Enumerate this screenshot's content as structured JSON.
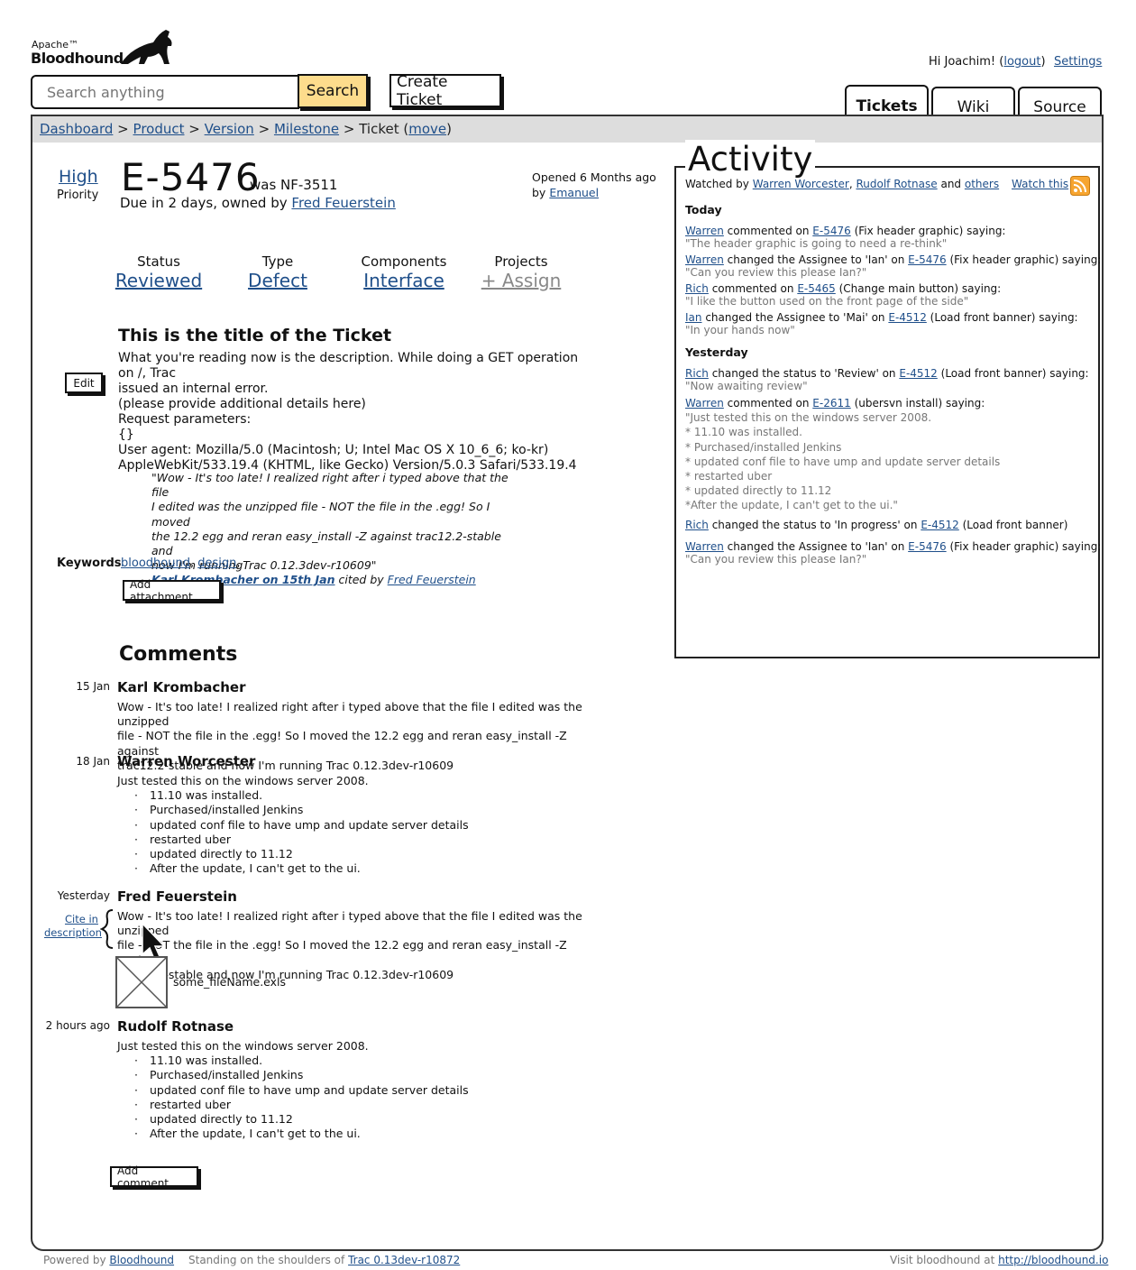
{
  "header": {
    "logo_apache": "Apache™",
    "logo_name": "Bloodhound",
    "greeting": "Hi Joachim! (",
    "logout": "logout",
    "greeting_end": ")",
    "settings": "Settings",
    "search_placeholder": "Search anything",
    "search_button": "Search",
    "create_ticket": "Create Ticket",
    "tabs": [
      {
        "label": "Tickets",
        "active": true
      },
      {
        "label": "Wiki",
        "active": false
      },
      {
        "label": "Source",
        "active": false
      }
    ]
  },
  "breadcrumb": {
    "items": [
      "Dashboard",
      "Product",
      "Version",
      "Milestone"
    ],
    "sep": ">",
    "current": "Ticket (",
    "move": "move",
    "current_end": ")"
  },
  "ticket": {
    "priority_value": "High",
    "priority_label": "Priority",
    "id": "E-5476",
    "was": "was NF-3511",
    "due": "Due in 2 days, owned by",
    "owner": "Fred Feuerstein",
    "opened": "Opened 6 Months ago",
    "opened_by": "by",
    "opened_by_name": "Emanuel",
    "fields": [
      {
        "label": "Status",
        "value": "Reviewed"
      },
      {
        "label": "Type",
        "value": "Defect"
      },
      {
        "label": "Components",
        "value": "Interface"
      },
      {
        "label": "Projects",
        "value": "+ Assign"
      }
    ],
    "title": "This is the title of the Ticket",
    "edit": "Edit",
    "description": [
      "What you're reading now is the description. While doing a GET operation on /, Trac",
      "issued an internal error.",
      "(please provide additional details here)",
      "Request parameters:",
      "{}",
      "User agent: Mozilla/5.0 (Macintosh; U; Intel Mac OS X 10_6_6; ko-kr)",
      "AppleWebKit/533.19.4 (KHTML, like Gecko) Version/5.0.3 Safari/533.19.4"
    ],
    "quote": [
      "\"Wow - It's too late! I realized right after i typed above that the file",
      "I edited was the unzipped file - NOT the file in the .egg! So I moved",
      "the 12.2 egg and reran easy_install -Z against trac12.2-stable and",
      "now I'm runningTrac 0.12.3dev-r10609\""
    ],
    "quote_author": "Karl Krombacher on 15th Jan",
    "quote_cited": "cited by",
    "quote_cited_by": "Fred Feuerstein",
    "keywords_label": "Keywords",
    "keywords": [
      "bloodhound",
      "design"
    ],
    "add_attachment": "Add attachment"
  },
  "comments": {
    "title": "Comments",
    "cite_link_1": "Cite in",
    "cite_link_2": "description",
    "items": [
      {
        "date": "15 Jan",
        "author": "Karl Krombacher",
        "lines": [
          "Wow - It's too late! I realized right after i typed above that the file I edited was the unzipped",
          "file - NOT the file in the .egg! So I moved the 12.2 egg and reran easy_install -Z against",
          "trac12.2-stable and now I'm running Trac 0.12.3dev-r10609"
        ]
      },
      {
        "date": "18 Jan",
        "author": "Warren Worcester",
        "intro": "Just tested this on the windows server 2008.",
        "bullets": [
          "11.10 was installed.",
          "Purchased/installed Jenkins",
          "updated conf file to have ump and update server details",
          "restarted uber",
          "updated directly to 11.12",
          "After the update, I can't get to the ui."
        ]
      },
      {
        "date": "Yesterday",
        "author": "Fred Feuerstein",
        "lines": [
          "Wow - It's too late! I realized right after i typed above that the file I edited was the unzipped",
          "file - NOT the file in the .egg! So I moved the 12.2 egg and reran easy_install -Z against",
          "trac12.2-stable and now I'm running Trac 0.12.3dev-r10609"
        ],
        "attachment": "some_fileName.exls"
      },
      {
        "date": "2 hours ago",
        "author": "Rudolf Rotnase",
        "intro": "Just tested this on the windows server 2008.",
        "bullets": [
          "11.10 was installed.",
          "Purchased/installed Jenkins",
          "updated conf file to have ump and update server details",
          "restarted uber",
          "updated directly to 11.12",
          "After the update, I can't get to the ui."
        ]
      }
    ],
    "add_comment": "Add comment"
  },
  "activity": {
    "title": "Activity",
    "watched_by": "Watched by",
    "watchers": [
      "Warren Worcester",
      "Rudolf Rotnase"
    ],
    "and": "and",
    "others": "others",
    "watch_this": "Watch this",
    "today": "Today",
    "yesterday": "Yesterday",
    "events": [
      {
        "user": "Warren",
        "action": "commented on",
        "ticket": "E-5476",
        "tail": "(Fix header graphic) saying:",
        "quote": "\"The header graphic is going to need a re-think\""
      },
      {
        "user": "Warren",
        "action": "changed the Assignee to 'Ian' on",
        "ticket": "E-5476",
        "tail": "(Fix header graphic) saying:",
        "quote": "\"Can you review this please Ian?\""
      },
      {
        "user": "Rich",
        "action": "commented on",
        "ticket": "E-5465",
        "tail": "(Change main button) saying:",
        "quote": "\"I like the button used on the front page of the side\""
      },
      {
        "user": "Ian",
        "action": "changed the Assignee to 'Mai' on",
        "ticket": "E-4512",
        "tail": "(Load front banner) saying:",
        "quote": "\"In your hands now\""
      },
      {
        "user": "Rich",
        "action": "changed the status to 'Review' on",
        "ticket": "E-4512",
        "tail": "(Load front banner) saying:",
        "quote": "\"Now awaiting review\""
      },
      {
        "user": "Warren",
        "action": "commented on",
        "ticket": "E-2611",
        "tail": "(ubersvn install) saying:",
        "quote_lines": [
          "\"Just tested this on the windows server 2008.",
          "* 11.10 was installed.",
          "* Purchased/installed Jenkins",
          "* updated conf file to have ump and update server details",
          "* restarted uber",
          "* updated directly to 11.12",
          "*After the update, I can't get to the ui.\""
        ]
      },
      {
        "user": "Rich",
        "action": "changed the status to  'In progress' on",
        "ticket": "E-4512",
        "tail": "(Load front banner)"
      },
      {
        "user": "Warren",
        "action": "changed the Assignee to 'Ian' on",
        "ticket": "E-5476",
        "tail": "(Fix header graphic) saying:",
        "quote": "\"Can you review this please Ian?\""
      }
    ]
  },
  "footer": {
    "powered": "Powered by",
    "powered_link": "Bloodhound",
    "shoulders": "Standing on the shoulders of",
    "trac_link": "Trac 0.13dev-r10872",
    "visit": "Visit bloodhound at",
    "visit_link": "http://bloodhound.io"
  }
}
